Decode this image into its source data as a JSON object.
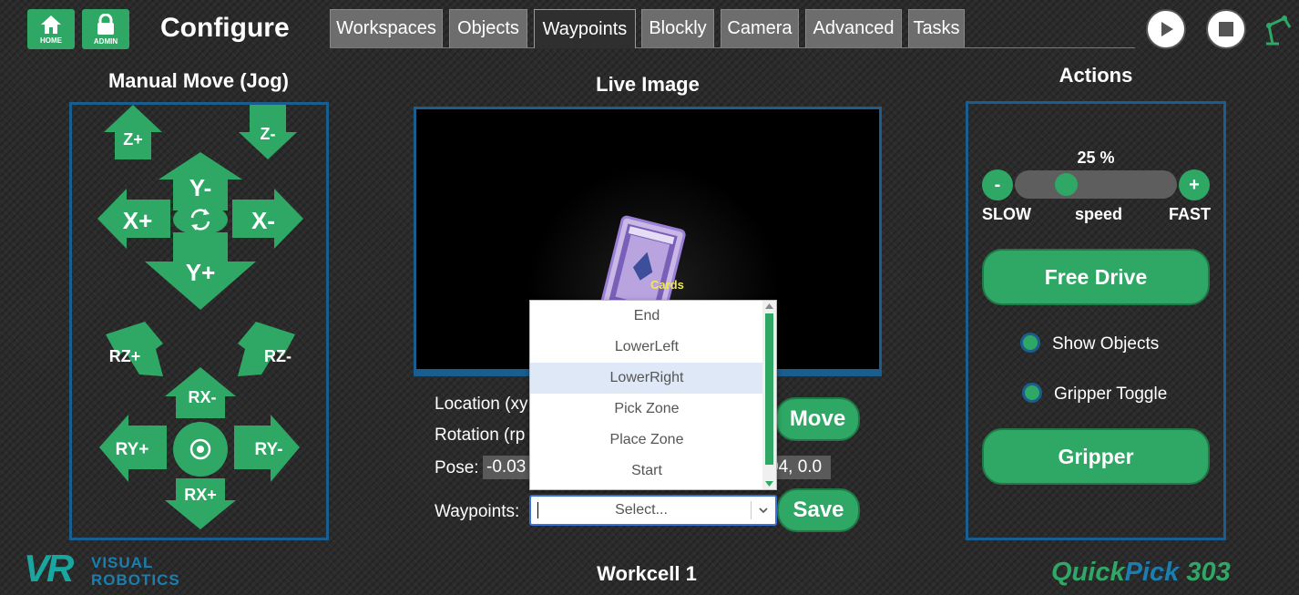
{
  "header": {
    "home_label": "HOME",
    "admin_label": "ADMIN",
    "title": "Configure",
    "tabs": [
      "Workspaces",
      "Objects",
      "Waypoints",
      "Blockly",
      "Camera",
      "Advanced",
      "Tasks"
    ],
    "active_tab": "Waypoints"
  },
  "jog": {
    "title": "Manual Move (Jog)",
    "buttons": {
      "z_plus": "Z+",
      "z_minus": "Z-",
      "y_minus": "Y-",
      "x_plus": "X+",
      "x_minus": "X-",
      "y_plus": "Y+",
      "rz_plus": "RZ+",
      "rz_minus": "RZ-",
      "rx_minus": "RX-",
      "ry_plus": "RY+",
      "ry_minus": "RY-",
      "rx_plus": "RX+"
    }
  },
  "live": {
    "title": "Live Image",
    "object_label": "Cards",
    "location_label": "Location (xy",
    "rotation_label": "Rotation (rp",
    "pose_label": "Pose:",
    "pose_left": "-0.03",
    "pose_right": "04, 0.0",
    "waypoints_label": "Waypoints:",
    "select_placeholder": "Select...",
    "move_button": "Move",
    "save_button": "Save",
    "dropdown_options": [
      "End",
      "LowerLeft",
      "LowerRight",
      "Pick Zone",
      "Place Zone",
      "Start"
    ],
    "dropdown_highlight": "LowerRight",
    "workcell": "Workcell 1"
  },
  "actions": {
    "title": "Actions",
    "speed_value": "25 %",
    "speed_fraction": 0.25,
    "minus": "-",
    "plus": "+",
    "slow": "SLOW",
    "speed": "speed",
    "fast": "FAST",
    "free_drive": "Free Drive",
    "show_objects": "Show Objects",
    "gripper_toggle": "Gripper Toggle",
    "gripper": "Gripper"
  },
  "branding": {
    "logo_mark": "VR",
    "logo_line1": "VISUAL",
    "logo_line2": "ROBOTICS",
    "product_a": "Quick",
    "product_b": "Pick",
    "product_c": "303"
  },
  "colors": {
    "accent": "#2fa866",
    "panel_border": "#1a5e8f",
    "highlight": "#dfe8f6"
  }
}
